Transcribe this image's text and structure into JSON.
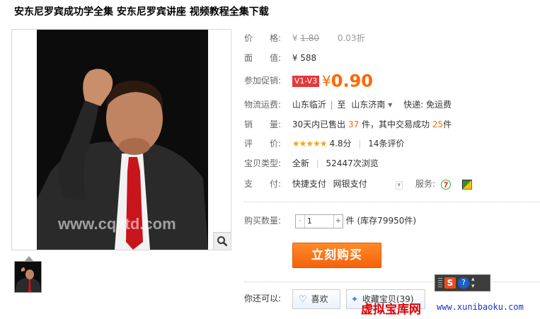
{
  "title": "安东尼罗宾成功学全集 安东尼罗宾讲座 视频教程全集下载",
  "image": {
    "watermark": "www.cqxtd.com"
  },
  "price": {
    "label": "价　　格:",
    "currency": "¥",
    "original": "1.80",
    "discount": "0.03折"
  },
  "face_value": {
    "label": "面　　值:",
    "value": "¥ 588"
  },
  "promo": {
    "label": "参加促销:",
    "badge": "V1-V3",
    "currency": "¥",
    "price": "0.90"
  },
  "shipping": {
    "label": "物流运费:",
    "from": "山东临沂",
    "to_prefix": "至",
    "to": "山东济南",
    "express": "快递: 免运费"
  },
  "sales": {
    "label": "销　　量:",
    "text1": "30天内已售出",
    "sold": "37",
    "text2": "件，其中交易成功",
    "success": "25",
    "text3": "件"
  },
  "rating": {
    "label": "评　　价:",
    "stars": "★★★★★",
    "score": "4.8分",
    "reviews": "14条评价"
  },
  "item_type": {
    "label": "宝贝类型:",
    "value": "全新",
    "views": "52447次浏览"
  },
  "payment": {
    "label": "支　　付:",
    "method1": "快捷支付",
    "method2": "网银支付",
    "service_label": "服务:"
  },
  "quantity": {
    "label": "购买数量:",
    "minus": "-",
    "value": "1",
    "plus": "+",
    "unit": "件",
    "stock": "(库存79950件)"
  },
  "buy_button": "立刻购买",
  "also": {
    "label": "你还可以:",
    "like": "喜欢",
    "fav": "收藏宝贝(39)"
  },
  "ime": {
    "logo": "S",
    "help": "?"
  },
  "site_watermark": {
    "name": "虚拟宝库网",
    "url": "www.xunibaoku.com"
  },
  "colors": {
    "accent": "#ff6600",
    "badge": "#e4393c",
    "stars": "#f9a20b"
  }
}
